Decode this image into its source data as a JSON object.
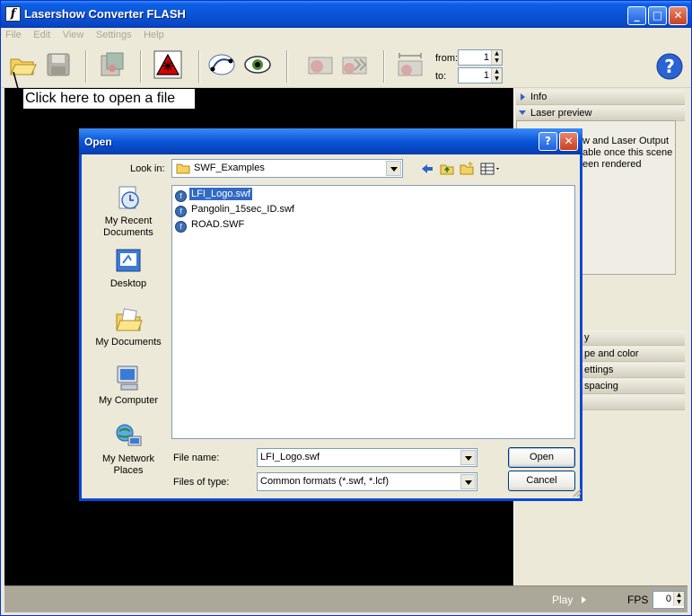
{
  "window": {
    "title": "Lasershow Converter FLASH",
    "icon_glyph": "f"
  },
  "menu": [
    "File",
    "Edit",
    "View",
    "Settings",
    "Help"
  ],
  "toolbar": {
    "from_label": "from:",
    "from_value": "1",
    "to_label": "to:",
    "to_value": "1"
  },
  "tooltip": "Click here to open a file",
  "right_panel": {
    "sections_top": [
      "Info",
      "Laser preview"
    ],
    "preview_text": [
      "w and Laser Output",
      "able once this scene",
      "een rendered"
    ],
    "sections_bottom": [
      "y",
      "pe and color",
      "ettings",
      "spacing",
      ""
    ]
  },
  "status": {
    "play_label": "Play",
    "fps_label": "FPS",
    "fps_value": "0"
  },
  "dialog": {
    "title": "Open",
    "look_in_label": "Look in:",
    "look_in_value": "SWF_Examples",
    "places": [
      "My Recent Documents",
      "Desktop",
      "My Documents",
      "My Computer",
      "My Network Places"
    ],
    "files": [
      {
        "name": "LFI_Logo.swf",
        "selected": true
      },
      {
        "name": "Pangolin_15sec_ID.swf",
        "selected": false
      },
      {
        "name": "ROAD.SWF",
        "selected": false
      }
    ],
    "file_name_label": "File name:",
    "file_name_value": "LFI_Logo.swf",
    "file_type_label": "Files of type:",
    "file_type_value": "Common formats (*.swf, *.lcf)",
    "open_button": "Open",
    "cancel_button": "Cancel"
  },
  "colors": {
    "title_blue": "#0A55D9",
    "selection": "#316AC5",
    "canvas": "#000000"
  }
}
